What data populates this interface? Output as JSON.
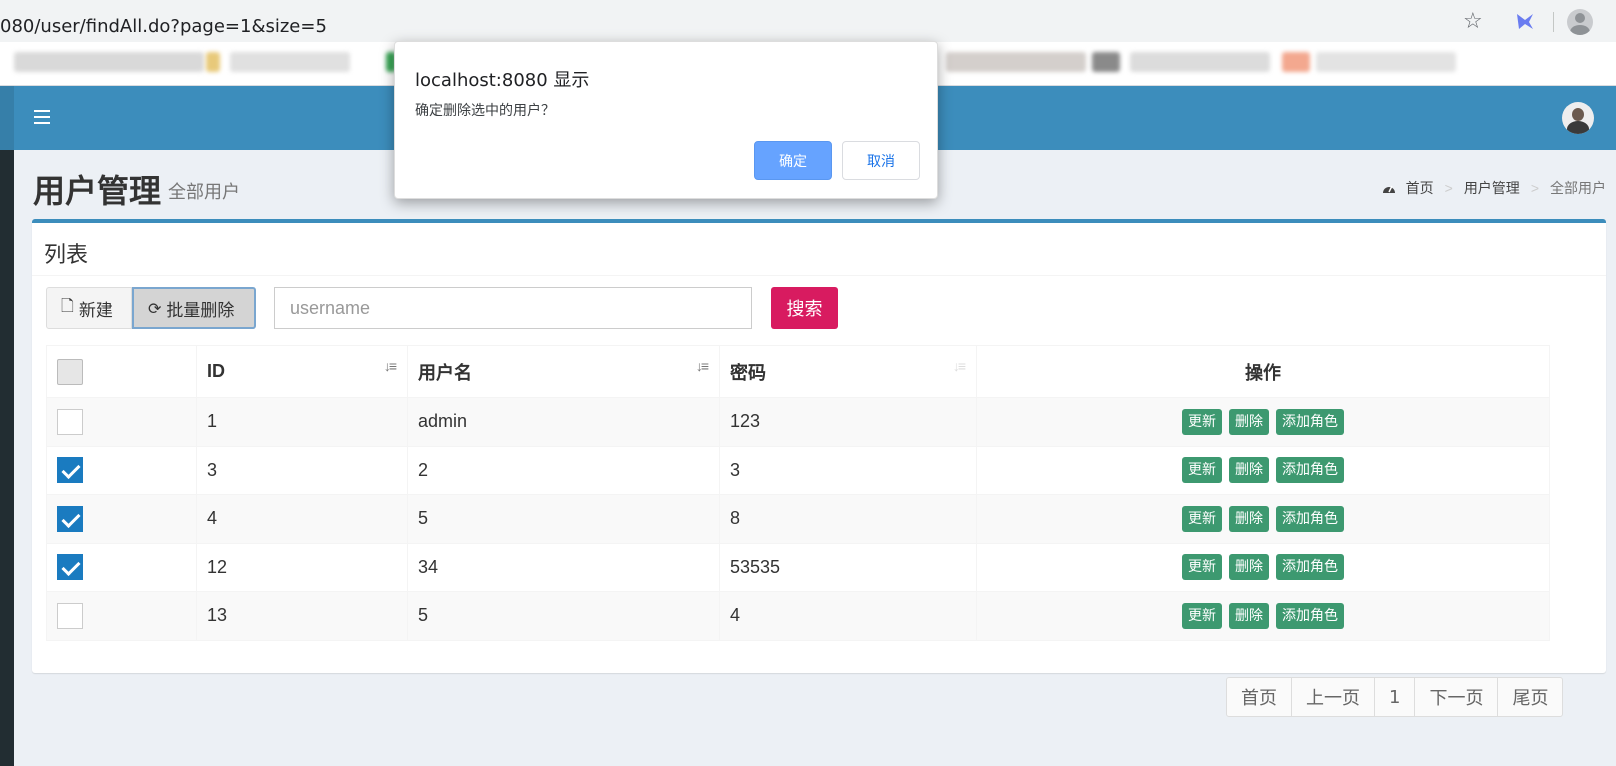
{
  "browser": {
    "url": "080/user/findAll.do?page=1&size=5"
  },
  "header": {
    "page_title": "用户管理",
    "page_subtitle": "全部用户",
    "breadcrumb": [
      "首页",
      "用户管理",
      "全部用户"
    ]
  },
  "box": {
    "title": "列表",
    "new_label": "新建",
    "batch_delete_label": "批量删除",
    "search_placeholder": "username",
    "search_label": "搜索"
  },
  "table": {
    "columns": [
      "ID",
      "用户名",
      "密码",
      "操作"
    ],
    "rows": [
      {
        "checked": false,
        "id": "1",
        "username": "admin",
        "password": "123"
      },
      {
        "checked": true,
        "id": "3",
        "username": "2",
        "password": "3"
      },
      {
        "checked": true,
        "id": "4",
        "username": "5",
        "password": "8"
      },
      {
        "checked": true,
        "id": "12",
        "username": "34",
        "password": "53535"
      },
      {
        "checked": false,
        "id": "13",
        "username": "5",
        "password": "4"
      }
    ],
    "actions": [
      "更新",
      "删除",
      "添加角色"
    ]
  },
  "pagination": [
    "首页",
    "上一页",
    "1",
    "下一页",
    "尾页"
  ],
  "dialog": {
    "title": "localhost:8080 显示",
    "message": "确定删除选中的用户？",
    "ok_label": "确定",
    "cancel_label": "取消"
  },
  "colors": {
    "header_blue": "#3c8dbc",
    "danger_pink": "#d81b60",
    "action_green": "#3d9970",
    "dialog_primary": "#66a3ff"
  }
}
